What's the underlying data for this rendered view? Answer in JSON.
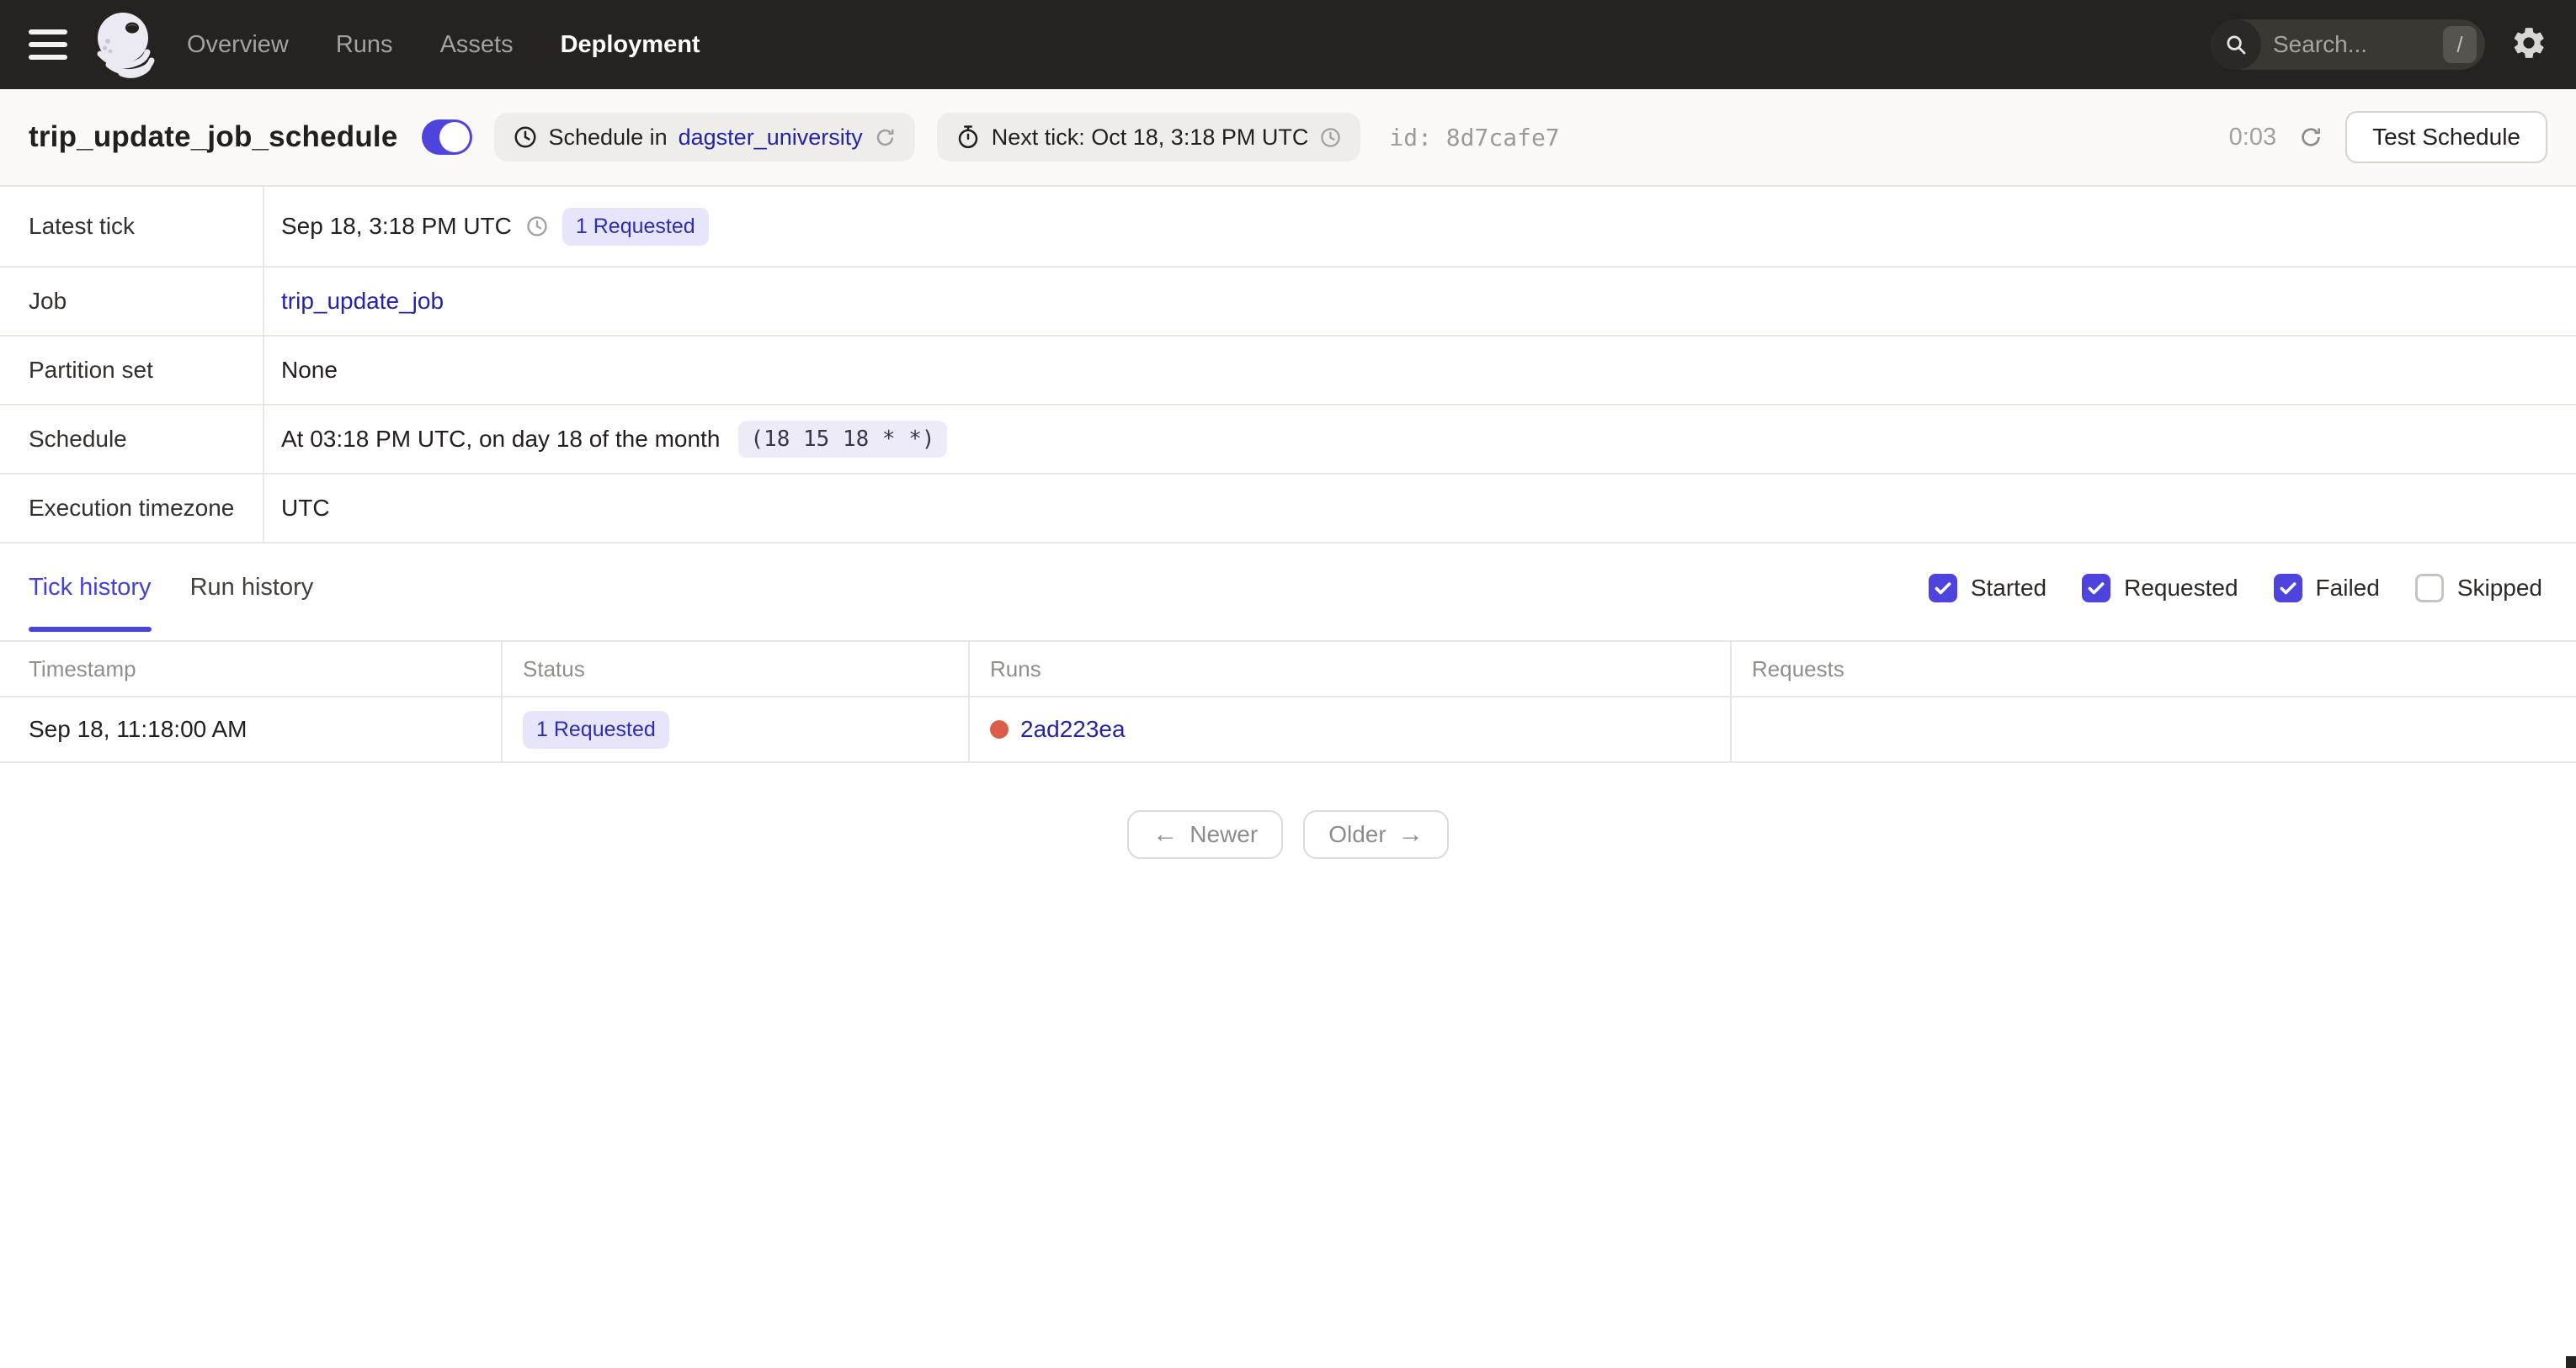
{
  "colors": {
    "accent_indigo": "#4F43DD",
    "link_navy": "#2424A8",
    "failed_red": "#DC5C4A",
    "nav_background": "#262220"
  },
  "topnav": {
    "items": [
      {
        "label": "Overview",
        "active": false
      },
      {
        "label": "Runs",
        "active": false
      },
      {
        "label": "Assets",
        "active": false
      },
      {
        "label": "Deployment",
        "active": true
      }
    ],
    "search": {
      "placeholder": "Search...",
      "shortcut": "/"
    }
  },
  "header": {
    "title": "trip_update_job_schedule",
    "toggle_on": true,
    "repo_badge": {
      "prefix": "Schedule in",
      "repo_link": "dagster_university"
    },
    "next_tick": "Next tick: Oct 18, 3:18 PM UTC",
    "id_label": "id:",
    "id_value": "8d7cafe7",
    "timer": "0:03",
    "test_button": "Test Schedule"
  },
  "details": {
    "latest_tick": {
      "label": "Latest tick",
      "time": "Sep 18, 3:18 PM UTC",
      "badge": "1 Requested"
    },
    "job": {
      "label": "Job",
      "link": "trip_update_job"
    },
    "partition_set": {
      "label": "Partition set",
      "value": "None"
    },
    "schedule": {
      "label": "Schedule",
      "value": "At 03:18 PM UTC, on day 18 of the month",
      "cron": "(18 15 18 * *)"
    },
    "timezone": {
      "label": "Execution timezone",
      "value": "UTC"
    }
  },
  "tabs": [
    {
      "label": "Tick history",
      "active": true
    },
    {
      "label": "Run history",
      "active": false
    }
  ],
  "filters": [
    {
      "label": "Started",
      "checked": true
    },
    {
      "label": "Requested",
      "checked": true
    },
    {
      "label": "Failed",
      "checked": true
    },
    {
      "label": "Skipped",
      "checked": false
    }
  ],
  "tick_table": {
    "headers": [
      "Timestamp",
      "Status",
      "Runs",
      "Requests"
    ],
    "rows": [
      {
        "timestamp": "Sep 18, 11:18:00 AM",
        "status_badge": "1 Requested",
        "run_id": "2ad223ea",
        "requests": ""
      }
    ]
  },
  "pagination": {
    "newer_arrow": "←",
    "newer": "Newer",
    "older": "Older",
    "older_arrow": "→"
  }
}
